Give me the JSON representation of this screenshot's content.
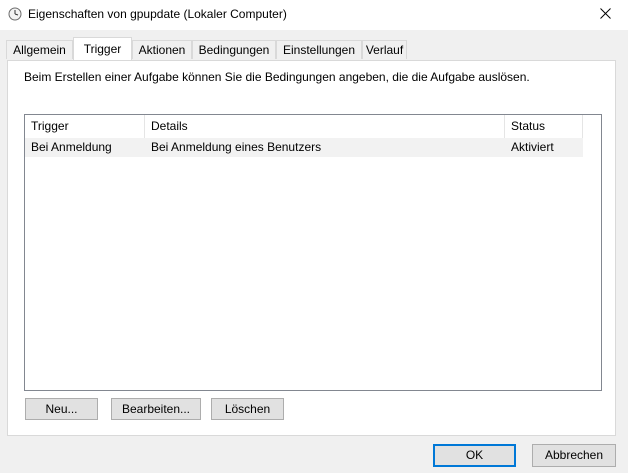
{
  "window": {
    "title": "Eigenschaften von gpupdate (Lokaler Computer)",
    "icon": "clock-icon",
    "close_icon": "close-icon"
  },
  "tabs": [
    {
      "label": "Allgemein",
      "active": false
    },
    {
      "label": "Trigger",
      "active": true
    },
    {
      "label": "Aktionen",
      "active": false
    },
    {
      "label": "Bedingungen",
      "active": false
    },
    {
      "label": "Einstellungen",
      "active": false
    },
    {
      "label": "Verlauf",
      "active": false
    }
  ],
  "trigger_panel": {
    "description": "Beim Erstellen einer Aufgabe können Sie die Bedingungen angeben, die die Aufgabe auslösen.",
    "columns": [
      "Trigger",
      "Details",
      "Status"
    ],
    "rows": [
      {
        "trigger": "Bei Anmeldung",
        "details": "Bei Anmeldung eines Benutzers",
        "status": "Aktiviert"
      }
    ],
    "buttons": {
      "new": "Neu...",
      "edit": "Bearbeiten...",
      "delete": "Löschen"
    }
  },
  "footer": {
    "ok": "OK",
    "cancel": "Abbrechen"
  },
  "colors": {
    "accent": "#0078d7",
    "selected_row": "#f2f2f2",
    "window_bg": "#f0f0f0"
  }
}
